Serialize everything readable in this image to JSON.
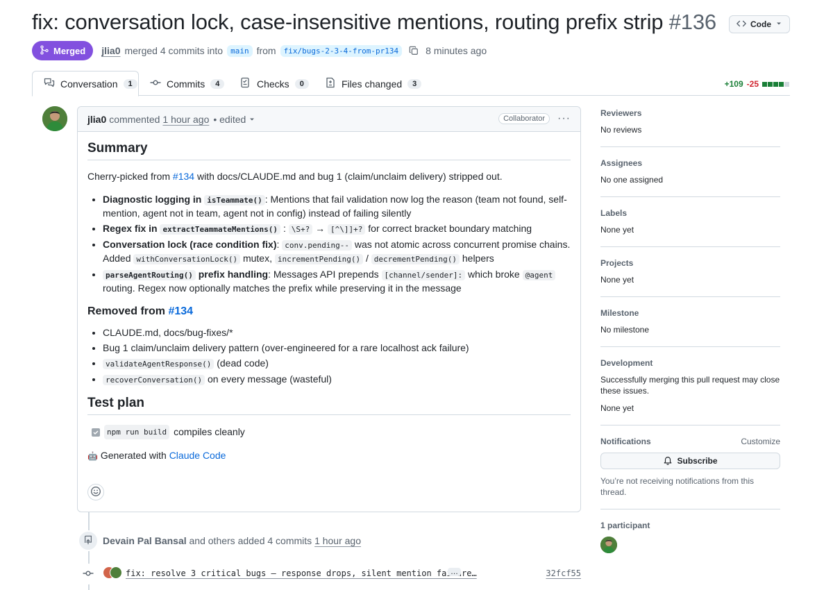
{
  "header": {
    "title": "fix: conversation lock, case-insensitive mentions, routing prefix strip",
    "number": "#136",
    "code_button": "Code",
    "status": "Merged",
    "merge_user": "jlia0",
    "merge_text": "merged 4 commits into",
    "base_branch": "main",
    "from_text": "from",
    "head_branch": "fix/bugs-2-3-4-from-pr134",
    "time_ago": "8 minutes ago"
  },
  "tabs": [
    {
      "label": "Conversation",
      "count": "1",
      "icon": "comment-discussion-icon"
    },
    {
      "label": "Commits",
      "count": "4",
      "icon": "commit-icon"
    },
    {
      "label": "Checks",
      "count": "0",
      "icon": "checklist-icon"
    },
    {
      "label": "Files changed",
      "count": "3",
      "icon": "file-diff-icon"
    }
  ],
  "diffstat": {
    "additions": "+109",
    "deletions": "-25",
    "colors": [
      "#1a7f37",
      "#1a7f37",
      "#1a7f37",
      "#1a7f37",
      "#d0d7de"
    ]
  },
  "comment": {
    "author": "jlia0",
    "action": "commented",
    "time": "1 hour ago",
    "edited": "• edited",
    "role": "Collaborator",
    "summary_heading": "Summary",
    "intro_pre": "Cherry-picked from",
    "intro_link": "#134",
    "intro_post": "with docs/CLAUDE.md and bug 1 (claim/unclaim delivery) stripped out.",
    "b1_bold": "Diagnostic logging in",
    "b1_code": "isTeammate()",
    "b1_text": ": Mentions that fail validation now log the reason (team not found, self-mention, agent not in team, agent not in config) instead of failing silently",
    "b2_bold": "Regex fix in",
    "b2_code": "extractTeammateMentions()",
    "b2_colon": ":",
    "b2_code_a": "\\S+?",
    "b2_arrow": "→",
    "b2_code_b": "[^\\]]+?",
    "b2_text": "for correct bracket boundary matching",
    "b3_bold": "Conversation lock (race condition fix)",
    "b3_colon": ":",
    "b3_code_a": "conv.pending--",
    "b3_text_a": "was not atomic across concurrent promise chains. Added",
    "b3_code_b": "withConversationLock()",
    "b3_text_b": "mutex,",
    "b3_code_c": "incrementPending()",
    "b3_slash": "/",
    "b3_code_d": "decrementPending()",
    "b3_text_c": "helpers",
    "b4_code_a": "parseAgentRouting()",
    "b4_bold": "prefix handling",
    "b4_text_a": ": Messages API prepends",
    "b4_code_b": "[channel/sender]:",
    "b4_text_b": "which broke",
    "b4_code_c": "@agent",
    "b4_text_c": "routing. Regex now optionally matches the prefix while preserving it in the message",
    "removed_heading_pre": "Removed from",
    "removed_heading_link": "#134",
    "r1": "CLAUDE.md, docs/bug-fixes/*",
    "r2": "Bug 1 claim/unclaim delivery pattern (over-engineered for a rare localhost ack failure)",
    "r3_code": "validateAgentResponse()",
    "r3_text": "(dead code)",
    "r4_code": "recoverConversation()",
    "r4_text": "on every message (wasteful)",
    "test_heading": "Test plan",
    "t1_code": "npm run build",
    "t1_text": "compiles cleanly",
    "generated_emoji": "🤖",
    "generated_pre": "Generated with",
    "generated_link": "Claude Code"
  },
  "sidebar": {
    "reviewers_h": "Reviewers",
    "reviewers_v": "No reviews",
    "assignees_h": "Assignees",
    "assignees_v": "No one assigned",
    "labels_h": "Labels",
    "labels_v": "None yet",
    "projects_h": "Projects",
    "projects_v": "None yet",
    "milestone_h": "Milestone",
    "milestone_v": "No milestone",
    "development_h": "Development",
    "development_text": "Successfully merging this pull request may close these issues.",
    "development_v": "None yet",
    "notifications_h": "Notifications",
    "customize": "Customize",
    "subscribe": "Subscribe",
    "notif_text": "You’re not receiving notifications from this thread.",
    "participants_h": "1 participant"
  },
  "timeline": {
    "event_author": "Devain Pal Bansal",
    "event_text": "and others added 4 commits",
    "event_time": "1 hour ago",
    "commit_msg": "fix: resolve 3 critical bugs — response drops, silent mention failure…",
    "commit_more": "…",
    "commit_sha": "32fcf55"
  }
}
